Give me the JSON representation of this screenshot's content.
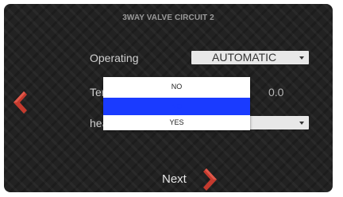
{
  "header": {
    "title": "3WAY VALVE CIRCUIT 2"
  },
  "rows": {
    "operating": {
      "label": "Operating",
      "value": "AUTOMATIC"
    },
    "temperature": {
      "label_visible": "Ter",
      "value": "0.0"
    },
    "heating": {
      "label_visible": "hea",
      "value_visible": "O"
    }
  },
  "dropdown": {
    "options": [
      "NO",
      "NO",
      "YES"
    ],
    "selected_index": 1
  },
  "navigation": {
    "next_label": "Next",
    "prev_icon": "chevron-left-icon",
    "next_icon": "chevron-right-icon"
  },
  "colors": {
    "background": "#222222",
    "accent_red": "#c43a2e",
    "selection_blue": "#1a3bff",
    "control_bg": "#e8e8e8"
  }
}
